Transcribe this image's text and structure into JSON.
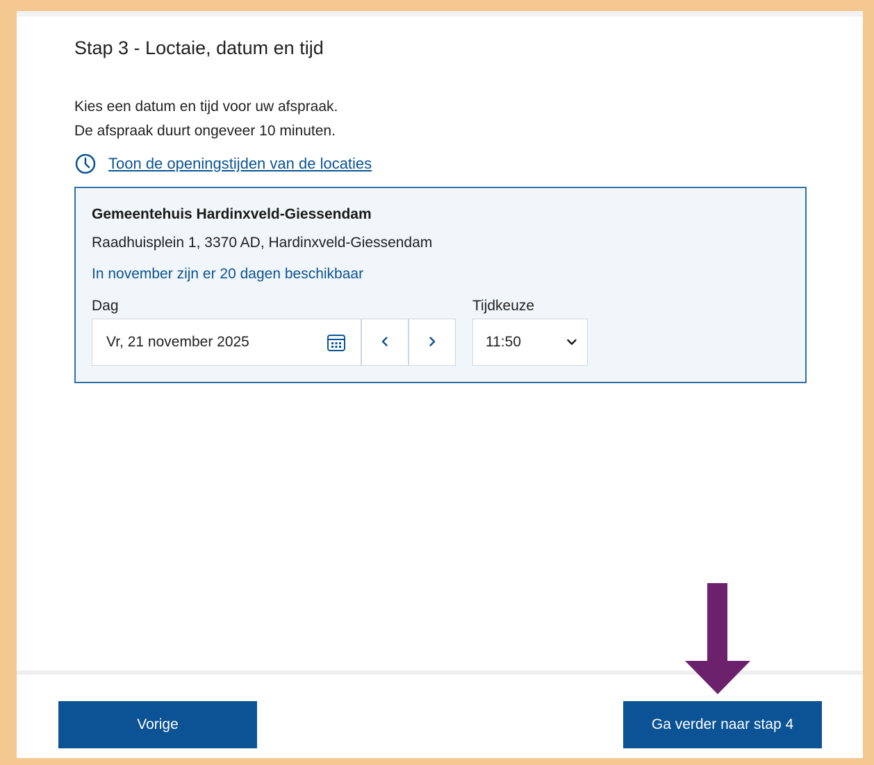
{
  "step": {
    "title": "Stap 3 - Loctaie, datum en tijd",
    "intro_line1": "Kies een datum en tijd voor uw afspraak.",
    "intro_line2": "De afspraak duurt ongeveer 10 minuten.",
    "hours_link": "Toon de openingstijden van de locaties"
  },
  "location": {
    "name": "Gemeentehuis Hardinxveld-Giessendam",
    "address": "Raadhuisplein 1, 3370 AD, Hardinxveld-Giessendam",
    "availability": "In november zijn er 20 dagen beschikbaar"
  },
  "form": {
    "day_label": "Dag",
    "day_value": "Vr, 21 november 2025",
    "time_label": "Tijdkeuze",
    "time_value": "11:50"
  },
  "footer": {
    "prev_label": "Vorige",
    "next_label": "Ga verder naar stap 4"
  },
  "colors": {
    "frame": "#f6c891",
    "primary": "#0b5394",
    "card_bg": "#f1f6fa",
    "annotation_arrow": "#6b216b"
  },
  "icons": {
    "hours": "clock-icon",
    "date": "calendar-icon",
    "prev": "chevron-left-icon",
    "next": "chevron-right-icon",
    "select": "chevron-down-icon"
  }
}
